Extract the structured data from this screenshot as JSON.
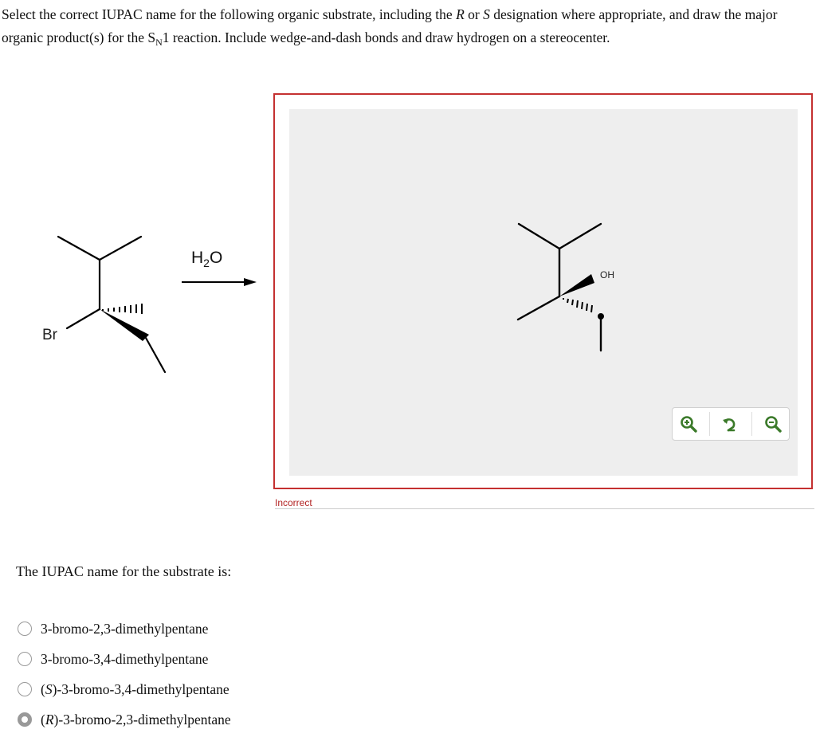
{
  "question": {
    "part1": "Select the correct IUPAC name for the following organic substrate, including the ",
    "r": "R",
    "or": " or ",
    "s": "S",
    "part2": " designation where appropriate, and draw the major organic product(s) for the S",
    "sub_n": "N",
    "part3": "1 reaction. Include wedge-and-dash bonds and draw hydrogen on a stereocenter."
  },
  "substrate": {
    "atom_label": "Br"
  },
  "reagent": {
    "h": "H",
    "sub": "2",
    "o": "O"
  },
  "product": {
    "atom_label": "OH"
  },
  "zoom_tools": [
    {
      "icon": "zoom-in-icon"
    },
    {
      "icon": "reset-view-icon"
    },
    {
      "icon": "zoom-out-icon"
    }
  ],
  "feedback": {
    "status": "Incorrect",
    "color": "#b22222"
  },
  "iupac_prompt": "The IUPAC name for the substrate is:",
  "options": [
    {
      "prefix": "",
      "prefix_label": "",
      "suffix": "",
      "text": "3-bromo-2,3-dimethylpentane",
      "selected": false
    },
    {
      "prefix": "",
      "prefix_label": "",
      "suffix": "",
      "text": "3-bromo-3,4-dimethylpentane",
      "selected": false
    },
    {
      "prefix": "(",
      "prefix_label": "S",
      "suffix": ")",
      "text": "-3-bromo-3,4-dimethylpentane",
      "selected": false
    },
    {
      "prefix": "(",
      "prefix_label": "R",
      "suffix": ")",
      "text": "-3-bromo-2,3-dimethylpentane",
      "selected": true
    }
  ],
  "colors": {
    "frame_border": "#c43030",
    "canvas_bg": "#eeeeee",
    "zoom_icon": "#3b7a2a"
  }
}
